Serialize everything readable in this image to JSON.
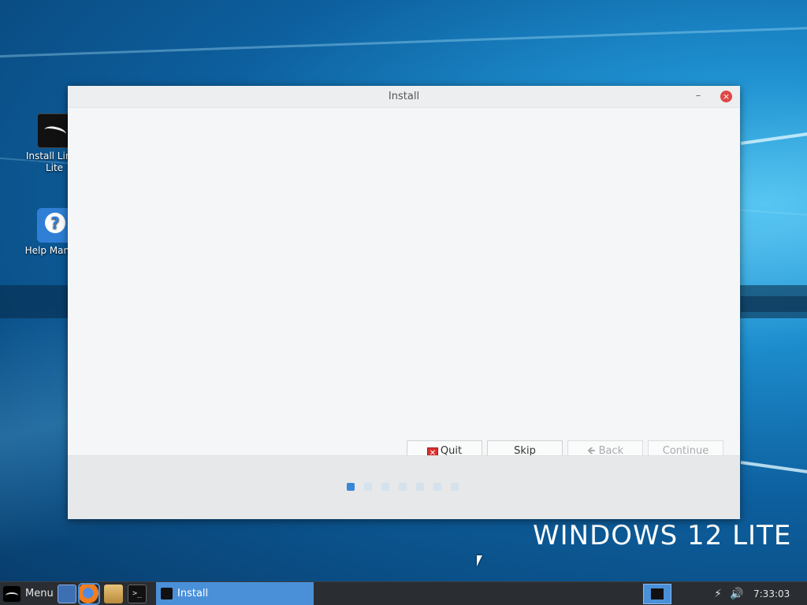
{
  "desktop": {
    "icons": [
      {
        "label": "Install Linux Lite",
        "icon": "install-linux-lite-icon"
      },
      {
        "label": "Help Manual",
        "icon": "help-manual-icon"
      }
    ],
    "brand_text": "WINDOWS 12 LITE"
  },
  "window": {
    "title": "Install",
    "minimize_label": "–",
    "close_label": "×",
    "buttons": {
      "quit": "Quit",
      "skip": "Skip",
      "back": "Back",
      "continue": "Continue"
    },
    "progress": {
      "total_steps": 7,
      "current_step": 1
    }
  },
  "taskbar": {
    "menu_label": "Menu",
    "quicklaunch": [
      "show-desktop-icon",
      "firefox-icon",
      "file-manager-icon",
      "terminal-icon"
    ],
    "terminal_glyph": ">_",
    "open_task": "Install",
    "clock": "7:33:03 pm"
  },
  "colors": {
    "accent": "#4a90d9",
    "close": "#e04646",
    "quit_icon": "#d93030",
    "dot_active": "#3a86d6",
    "dot_inactive": "#d4e2ee",
    "taskbar": "#2a2d31"
  }
}
